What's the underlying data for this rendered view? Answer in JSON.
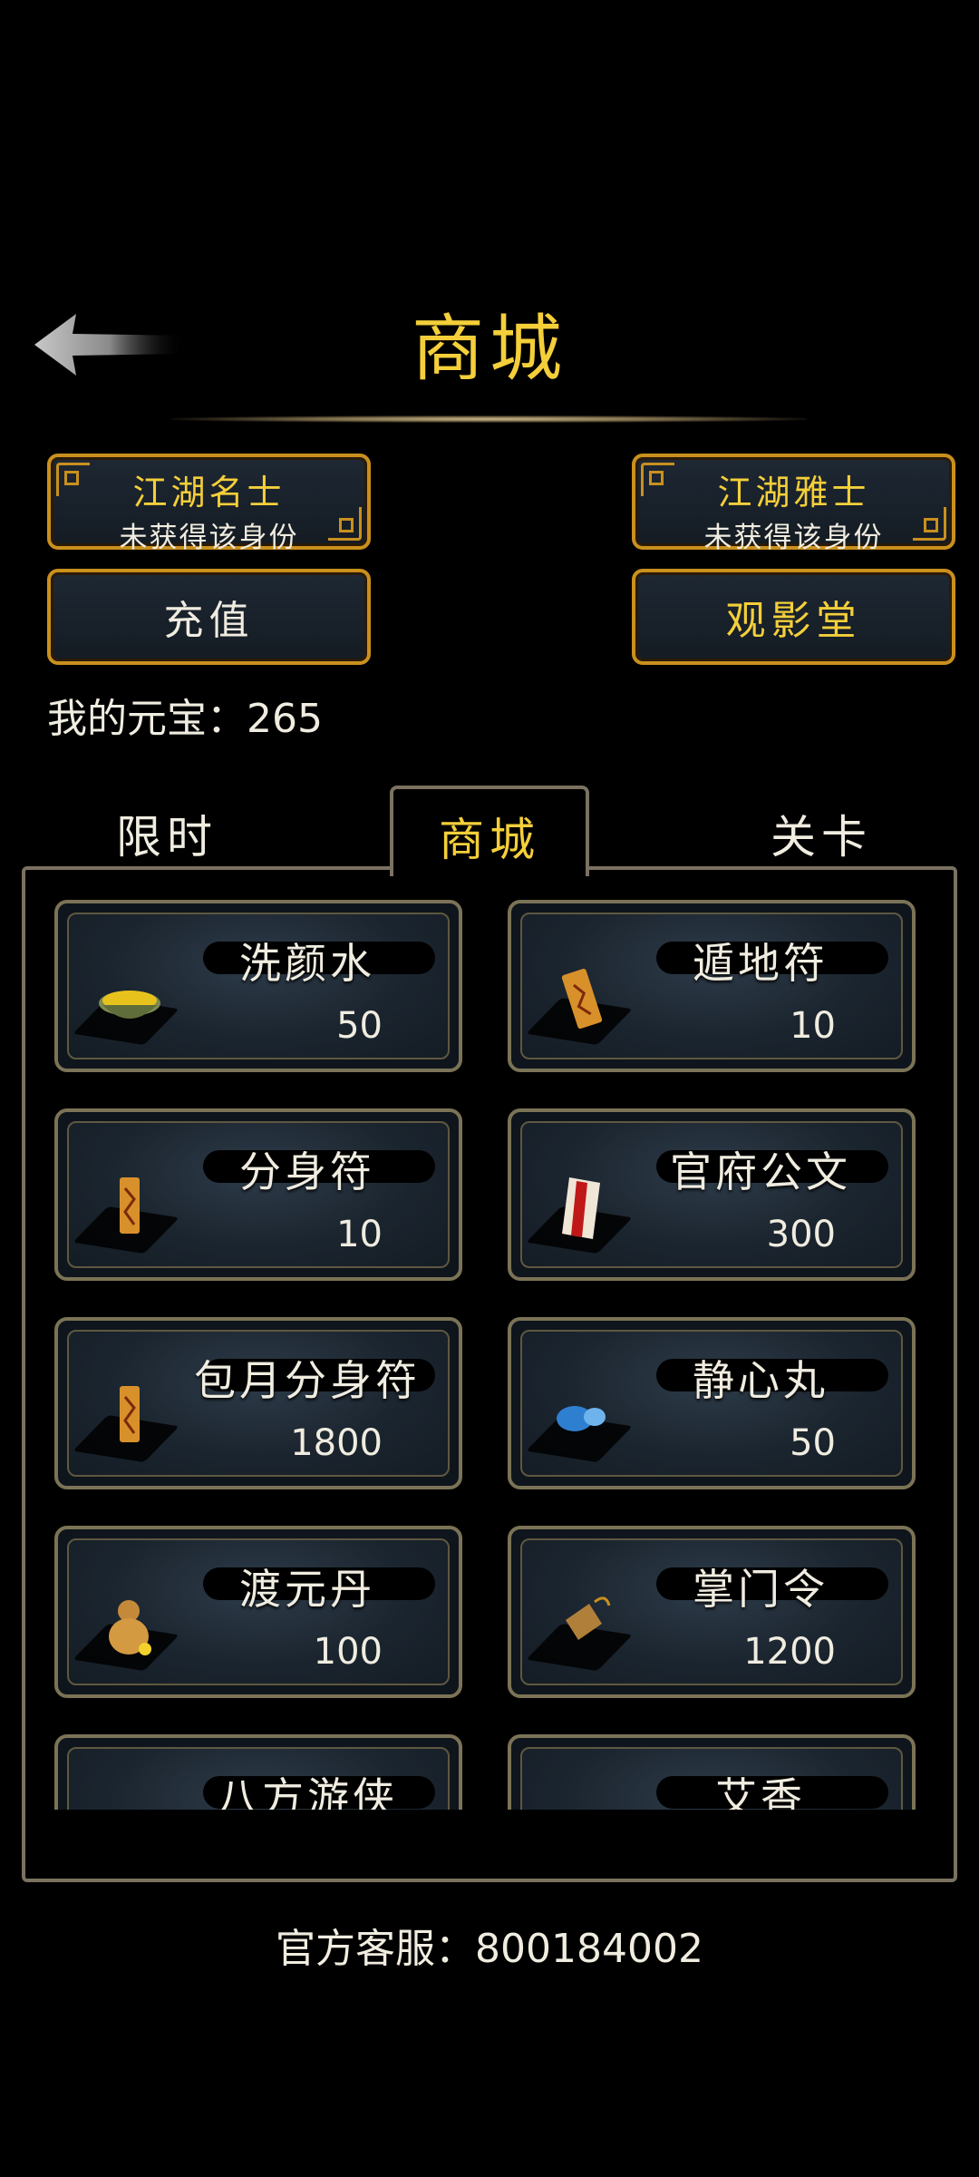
{
  "header": {
    "title": "商城",
    "back_icon": "back-arrow-icon"
  },
  "identities": [
    {
      "title": "江湖名士",
      "status": "未获得该身份"
    },
    {
      "title": "江湖雅士",
      "status": "未获得该身份"
    }
  ],
  "buttons": {
    "recharge": "充值",
    "cinema": "观影堂"
  },
  "balance": {
    "label": "我的元宝：",
    "value": "265"
  },
  "tabs": [
    "限时",
    "商城",
    "关卡"
  ],
  "active_tab": "商城",
  "items": [
    {
      "name": "洗颜水",
      "price": "50",
      "icon": "bowl-icon"
    },
    {
      "name": "遁地符",
      "price": "10",
      "icon": "talisman-icon"
    },
    {
      "name": "分身符",
      "price": "10",
      "icon": "talisman-icon"
    },
    {
      "name": "官府公文",
      "price": "300",
      "icon": "document-icon"
    },
    {
      "name": "包月分身符",
      "price": "1800",
      "icon": "talisman-icon"
    },
    {
      "name": "静心丸",
      "price": "50",
      "icon": "pill-icon"
    },
    {
      "name": "渡元丹",
      "price": "100",
      "icon": "gourd-icon"
    },
    {
      "name": "掌门令",
      "price": "1200",
      "icon": "token-icon"
    },
    {
      "name": "八方游侠",
      "price": "",
      "icon": "mask-icon"
    },
    {
      "name": "艾香",
      "price": "",
      "icon": "incense-icon"
    }
  ],
  "footer": {
    "label": "官方客服：",
    "value": "800184002"
  },
  "colors": {
    "gold": "#f4cf3a",
    "frame": "#c9901e",
    "panel_border": "#7a7260"
  }
}
